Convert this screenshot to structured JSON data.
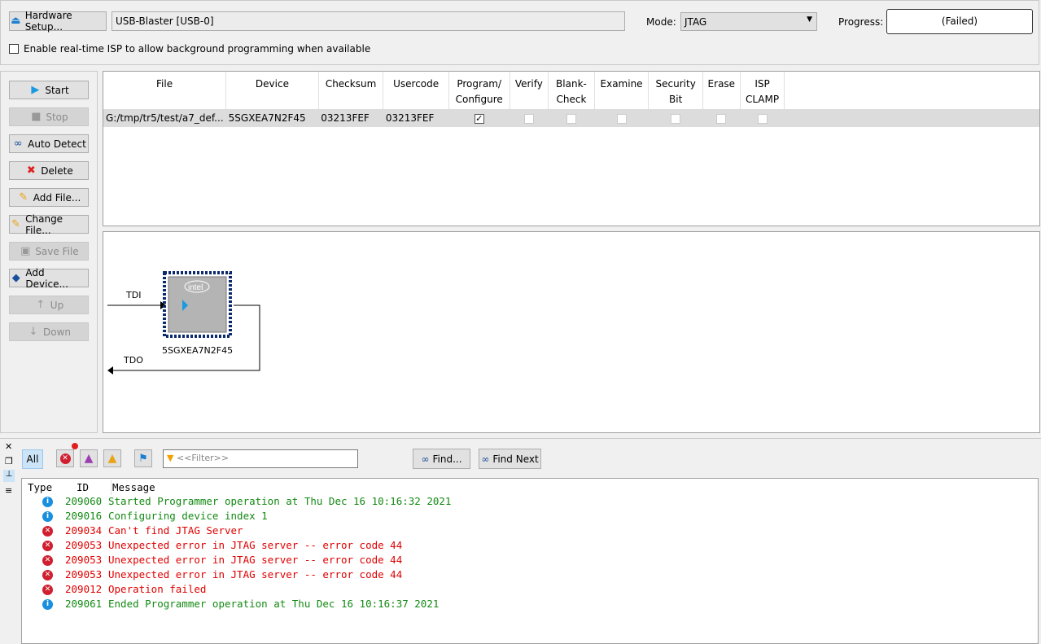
{
  "top": {
    "hardware_setup": "Hardware Setup...",
    "hardware": "USB-Blaster [USB-0]",
    "mode_label": "Mode:",
    "mode": "JTAG",
    "progress_label": "Progress:",
    "progress": "(Failed)",
    "realtime_isp": "Enable real-time ISP to allow background programming when available",
    "realtime_isp_checked": false
  },
  "sidebar": [
    {
      "label": "Start",
      "icon": "start-icon",
      "enabled": true
    },
    {
      "label": "Stop",
      "icon": "stop-icon",
      "enabled": false
    },
    {
      "label": "Auto Detect",
      "icon": "binoculars-icon",
      "enabled": true
    },
    {
      "label": "Delete",
      "icon": "delete-icon",
      "enabled": true
    },
    {
      "label": "Add File...",
      "icon": "add-file-icon",
      "enabled": true
    },
    {
      "label": "Change File...",
      "icon": "change-file-icon",
      "enabled": true
    },
    {
      "label": "Save File",
      "icon": "save-file-icon",
      "enabled": false
    },
    {
      "label": "Add Device...",
      "icon": "add-device-icon",
      "enabled": true
    },
    {
      "label": "Up",
      "icon": "up-icon",
      "enabled": false
    },
    {
      "label": "Down",
      "icon": "down-icon",
      "enabled": false
    }
  ],
  "table": {
    "headers": [
      [
        "File"
      ],
      [
        "Device"
      ],
      [
        "Checksum"
      ],
      [
        "Usercode"
      ],
      [
        "Program/",
        "Configure"
      ],
      [
        "Verify"
      ],
      [
        "Blank-",
        "Check"
      ],
      [
        "Examine"
      ],
      [
        "Security",
        "Bit"
      ],
      [
        "Erase"
      ],
      [
        "ISP",
        "CLAMP"
      ]
    ],
    "rows": [
      {
        "file": "G:/tmp/tr5/test/a7_def...",
        "device": "5SGXEA7N2F45",
        "checksum": "03213FEF",
        "usercode": "03213FEF",
        "program": true,
        "verify": false,
        "blank_check": false,
        "examine": false,
        "security_bit": false,
        "erase": false,
        "isp_clamp": false
      }
    ]
  },
  "chain": {
    "tdi": "TDI",
    "tdo": "TDO",
    "device": "5SGXEA7N2F45",
    "logo": "intel"
  },
  "messages": {
    "filters": {
      "all": "All"
    },
    "filter_placeholder": "<<Filter>>",
    "find": "Find...",
    "find_next": "Find Next",
    "columns": {
      "type": "Type",
      "id": "ID",
      "message": "Message"
    },
    "colors": {
      "info": "#138a13",
      "error": "#e00000"
    },
    "rows": [
      {
        "type": "info",
        "id": "209060",
        "message": "Started Programmer operation at Thu Dec 16 10:16:32 2021"
      },
      {
        "type": "info",
        "id": "209016",
        "message": "Configuring device index 1"
      },
      {
        "type": "error",
        "id": "209034",
        "message": "Can't find JTAG Server"
      },
      {
        "type": "error",
        "id": "209053",
        "message": "Unexpected error in JTAG server -- error code 44"
      },
      {
        "type": "error",
        "id": "209053",
        "message": "Unexpected error in JTAG server -- error code 44"
      },
      {
        "type": "error",
        "id": "209053",
        "message": "Unexpected error in JTAG server -- error code 44"
      },
      {
        "type": "error",
        "id": "209012",
        "message": "Operation failed"
      },
      {
        "type": "info",
        "id": "209061",
        "message": "Ended Programmer operation at Thu Dec 16 10:16:37 2021"
      }
    ]
  }
}
